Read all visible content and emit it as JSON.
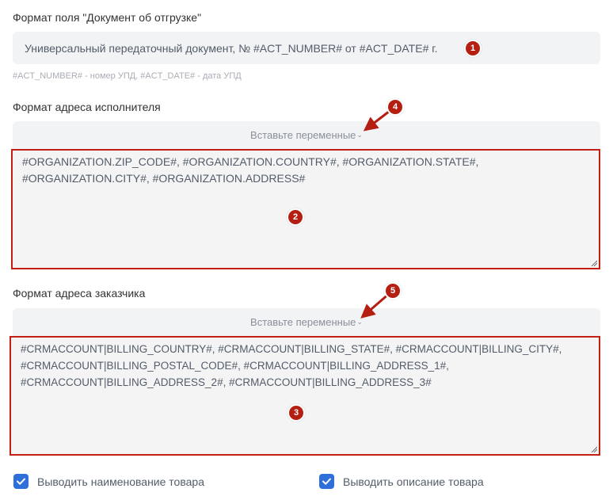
{
  "shipment_doc": {
    "label": "Формат поля \"Документ об отгрузке\"",
    "value": "Универсальный передаточный документ, № #ACT_NUMBER# от #ACT_DATE# г.",
    "hint": "#ACT_NUMBER# - номер УПД, #ACT_DATE# - дата УПД"
  },
  "executor_address": {
    "label": "Формат адреса исполнителя",
    "insert_variables": "Вставьте переменные",
    "lines": [
      "#ORGANIZATION.ZIP_CODE#, #ORGANIZATION.COUNTRY#, #ORGANIZATION.STATE#,",
      "#ORGANIZATION.CITY#, #ORGANIZATION.ADDRESS#"
    ]
  },
  "customer_address": {
    "label": "Формат адреса заказчика",
    "insert_variables": "Вставьте переменные",
    "lines": [
      "#CRMACCOUNT|BILLING_COUNTRY#, #CRMACCOUNT|BILLING_STATE#, #CRMACCOUNT|BILLING_CITY#,",
      "#CRMACCOUNT|BILLING_POSTAL_CODE#, #CRMACCOUNT|BILLING_ADDRESS_1#,",
      "#CRMACCOUNT|BILLING_ADDRESS_2#, #CRMACCOUNT|BILLING_ADDRESS_3#"
    ]
  },
  "checkboxes": [
    {
      "label": "Выводить наименование товара",
      "checked": true
    },
    {
      "label": "Выводить описание товара",
      "checked": true
    }
  ],
  "badges": [
    "1",
    "2",
    "3",
    "4",
    "5"
  ],
  "colors": {
    "annotation_red": "#b51f12",
    "highlight_border": "#c41f13",
    "checkbox_blue": "#2f6fd9",
    "field_bg": "#f2f3f5"
  },
  "icons": {
    "chevron": "chevron-down-icon",
    "check": "checkmark-icon",
    "arrow": "red-arrow-icon"
  }
}
